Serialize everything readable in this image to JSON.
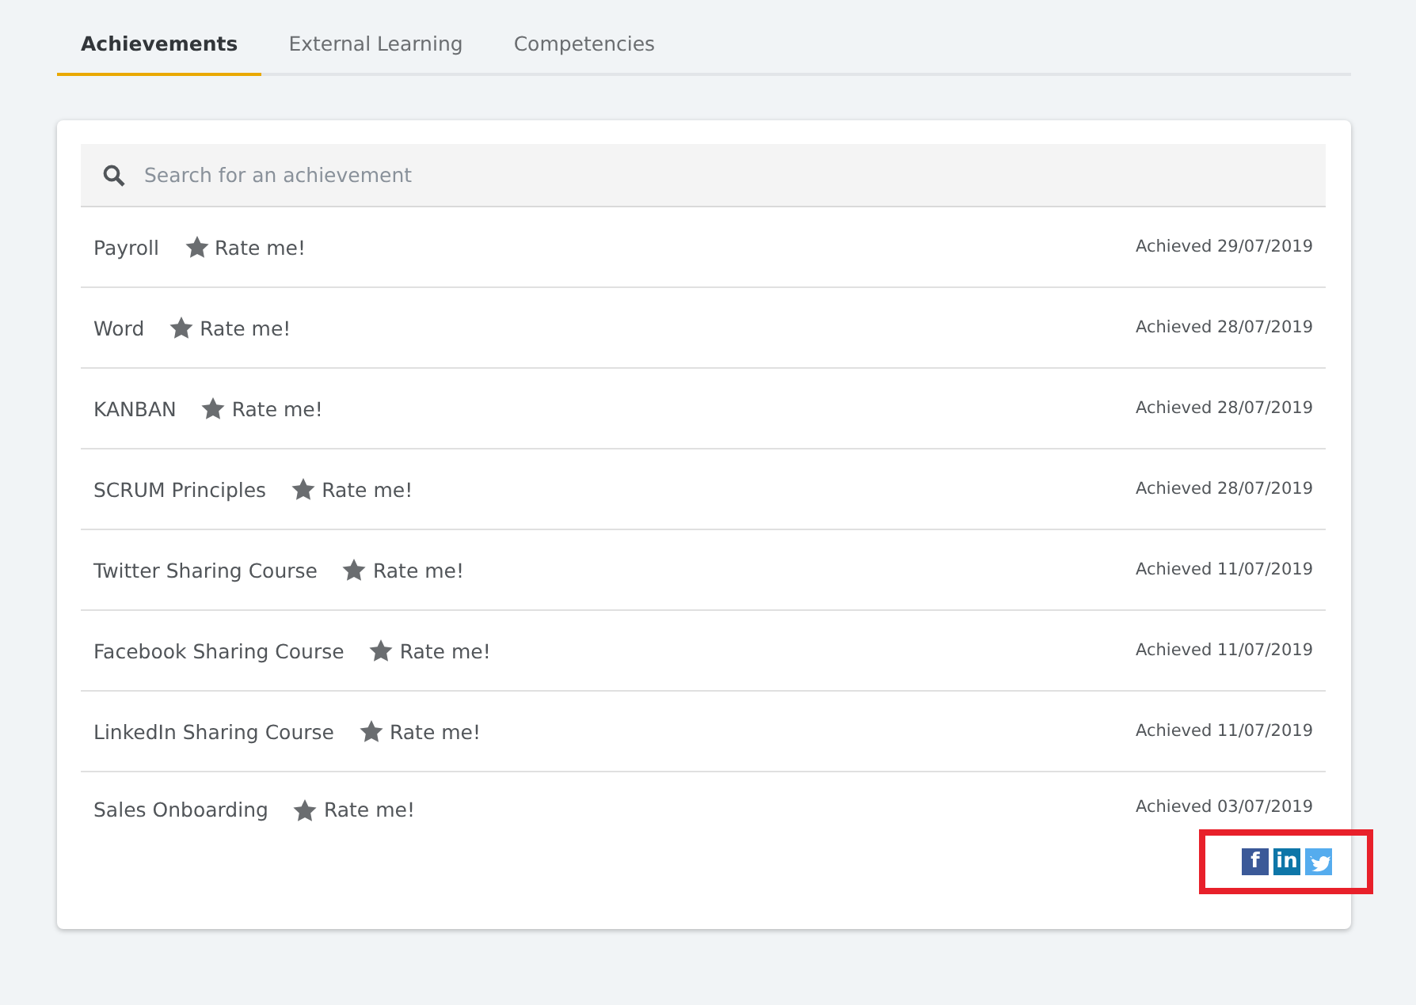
{
  "tabs": [
    {
      "label": "Achievements",
      "selected": true
    },
    {
      "label": "External Learning",
      "selected": false
    },
    {
      "label": "Competencies",
      "selected": false
    }
  ],
  "search": {
    "placeholder": "Search for an achievement"
  },
  "achievements": [
    {
      "name": "Payroll",
      "rate": "Rate me!",
      "date": "Achieved 29/07/2019"
    },
    {
      "name": "Word",
      "rate": "Rate me!",
      "date": "Achieved 28/07/2019"
    },
    {
      "name": "KANBAN",
      "rate": "Rate me!",
      "date": "Achieved 28/07/2019"
    },
    {
      "name": "SCRUM Principles",
      "rate": "Rate me!",
      "date": "Achieved 28/07/2019"
    },
    {
      "name": "Twitter Sharing Course",
      "rate": "Rate me!",
      "date": "Achieved 11/07/2019"
    },
    {
      "name": "Facebook Sharing Course",
      "rate": "Rate me!",
      "date": "Achieved 11/07/2019"
    },
    {
      "name": "LinkedIn Sharing Course",
      "rate": "Rate me!",
      "date": "Achieved 11/07/2019"
    },
    {
      "name": "Sales Onboarding",
      "rate": "Rate me!",
      "date": "Achieved 03/07/2019",
      "share": [
        {
          "kind": "facebook",
          "label": "f"
        },
        {
          "kind": "linkedin",
          "label": "in"
        },
        {
          "kind": "twitter"
        }
      ],
      "highlighted": true
    }
  ]
}
